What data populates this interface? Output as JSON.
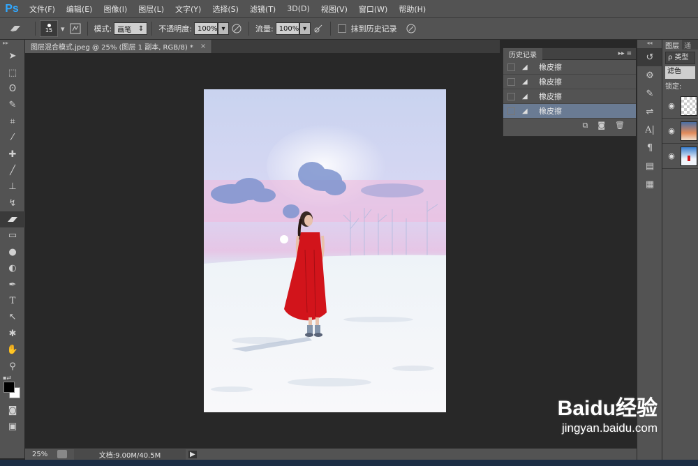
{
  "app": {
    "logo": "Ps"
  },
  "menu": [
    "文件(F)",
    "编辑(E)",
    "图像(I)",
    "图层(L)",
    "文字(Y)",
    "选择(S)",
    "滤镜(T)",
    "3D(D)",
    "视图(V)",
    "窗口(W)",
    "帮助(H)"
  ],
  "options": {
    "brush_size": "15",
    "mode_label": "模式:",
    "mode_value": "画笔",
    "opacity_label": "不透明度:",
    "opacity_value": "100%",
    "flow_label": "流量:",
    "flow_value": "100%",
    "erase_history_label": "抹到历史记录"
  },
  "document": {
    "tab_title": "图层混合模式.jpeg @ 25% (图层 1 副本, RGB/8) *"
  },
  "status": {
    "zoom": "25%",
    "doc_info": "文档:9.00M/40.5M"
  },
  "history": {
    "title": "历史记录",
    "items": [
      {
        "label": "橡皮擦",
        "selected": false
      },
      {
        "label": "橡皮擦",
        "selected": false
      },
      {
        "label": "橡皮擦",
        "selected": false
      },
      {
        "label": "橡皮擦",
        "selected": true
      }
    ]
  },
  "layers": {
    "tab": "图层",
    "tab2": "通",
    "kind_filter": "ρ 类型",
    "blend_mode": "滤色",
    "lock_label": "锁定:"
  },
  "watermark": {
    "brand": "Baidu经验",
    "url": "jingyan.baidu.com"
  },
  "colors": {
    "selection": "#6a7b93",
    "panel": "#535353",
    "canvas_bg": "#282828",
    "dress": "#d2141b"
  }
}
